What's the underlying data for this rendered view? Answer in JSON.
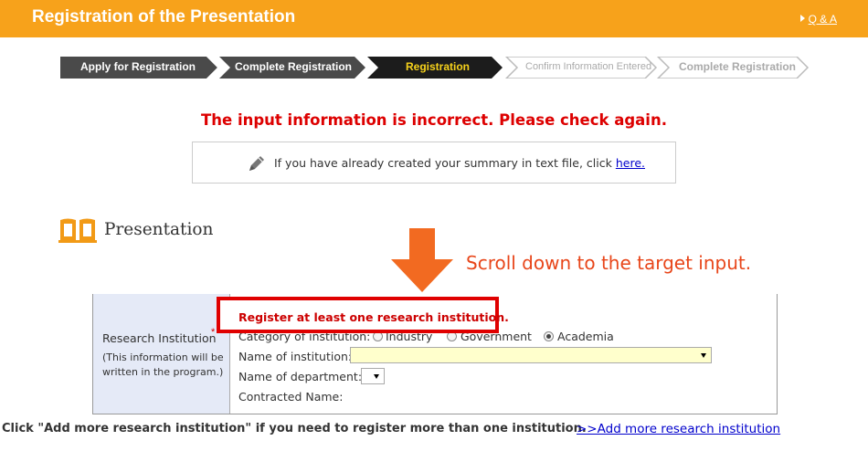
{
  "header": {
    "title": "Registration of the Presentation",
    "qa_link": "Q & A",
    "bg_color": "#f7a21b"
  },
  "steps": [
    {
      "label": "Apply for Registration",
      "state": "done"
    },
    {
      "label": "Complete Registration",
      "state": "done"
    },
    {
      "label": "Registration",
      "state": "current"
    },
    {
      "label": "Confirm Information Entered",
      "state": "pending"
    },
    {
      "label": "Complete Registration",
      "state": "pending"
    }
  ],
  "error_message": "The input information is incorrect. Please check again.",
  "summary": {
    "icon": "pencil-icon",
    "text": "If you have already created your summary in text file, click",
    "link": "here."
  },
  "section": {
    "icon": "book-icon",
    "title": "Presentation"
  },
  "annotation": {
    "icon": "down-arrow-icon",
    "text": "Scroll down to the target input."
  },
  "form": {
    "label": "Research Institution",
    "required_mark": "*",
    "note_line1": "(This information will be",
    "note_line2": "written in the program.)",
    "error_text": "Register at least one research institution.",
    "category_label": "Category of institution:",
    "category_options": [
      "Industry",
      "Government",
      "Academia"
    ],
    "category_selected": "Academia",
    "institution_label": "Name of institution:",
    "department_label": "Name of department:",
    "contracted_label": "Contracted Name:"
  },
  "bottom": {
    "note": "Click \"Add more research institution\" if you need to register more than one institution.",
    "link": ">>Add more research institution"
  },
  "colors": {
    "error_red": "#dd0000",
    "annotation_orange": "#e8461a",
    "link_blue": "#0000cc"
  }
}
